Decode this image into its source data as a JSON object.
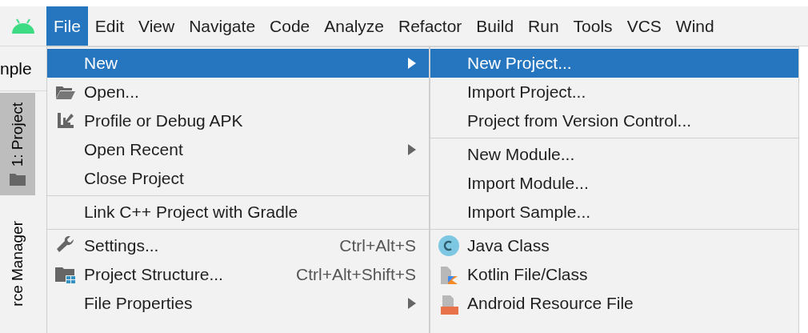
{
  "menubar": {
    "items": [
      {
        "label": "File",
        "selected": true
      },
      {
        "label": "Edit",
        "selected": false
      },
      {
        "label": "View",
        "selected": false
      },
      {
        "label": "Navigate",
        "selected": false
      },
      {
        "label": "Code",
        "selected": false
      },
      {
        "label": "Analyze",
        "selected": false
      },
      {
        "label": "Refactor",
        "selected": false
      },
      {
        "label": "Build",
        "selected": false
      },
      {
        "label": "Run",
        "selected": false
      },
      {
        "label": "Tools",
        "selected": false
      },
      {
        "label": "VCS",
        "selected": false
      },
      {
        "label": "Wind",
        "selected": false
      }
    ]
  },
  "left_panel": {
    "tab": "nple",
    "tool_windows": [
      {
        "label": "1: Project",
        "selected": true
      },
      {
        "label": "rce Manager",
        "selected": false
      }
    ]
  },
  "file_menu": {
    "items": [
      {
        "kind": "item",
        "label": "New",
        "has_submenu": true,
        "selected": true
      },
      {
        "kind": "item",
        "label": "Open...",
        "has_submenu": false,
        "selected": false
      },
      {
        "kind": "item",
        "label": "Profile or Debug APK",
        "has_submenu": false,
        "selected": false
      },
      {
        "kind": "item",
        "label": "Open Recent",
        "has_submenu": true,
        "selected": false
      },
      {
        "kind": "item",
        "label": "Close Project",
        "has_submenu": false,
        "selected": false
      },
      {
        "kind": "separator"
      },
      {
        "kind": "item",
        "label": "Link C++ Project with Gradle",
        "has_submenu": false,
        "selected": false
      },
      {
        "kind": "separator"
      },
      {
        "kind": "item",
        "label": "Settings...",
        "shortcut": "Ctrl+Alt+S",
        "has_submenu": false,
        "selected": false
      },
      {
        "kind": "item",
        "label": "Project Structure...",
        "shortcut": "Ctrl+Alt+Shift+S",
        "has_submenu": false,
        "selected": false
      },
      {
        "kind": "item",
        "label": "File Properties",
        "has_submenu": true,
        "selected": false
      }
    ]
  },
  "new_submenu": {
    "items": [
      {
        "kind": "item",
        "label": "New Project...",
        "selected": true
      },
      {
        "kind": "item",
        "label": "Import Project...",
        "selected": false
      },
      {
        "kind": "item",
        "label": "Project from Version Control...",
        "selected": false
      },
      {
        "kind": "separator"
      },
      {
        "kind": "item",
        "label": "New Module...",
        "selected": false
      },
      {
        "kind": "item",
        "label": "Import Module...",
        "selected": false
      },
      {
        "kind": "item",
        "label": "Import Sample...",
        "selected": false
      },
      {
        "kind": "separator"
      },
      {
        "kind": "item",
        "label": "Java Class",
        "selected": false
      },
      {
        "kind": "item",
        "label": "Kotlin File/Class",
        "selected": false
      },
      {
        "kind": "item",
        "label": "Android Resource File",
        "selected": false
      }
    ]
  }
}
